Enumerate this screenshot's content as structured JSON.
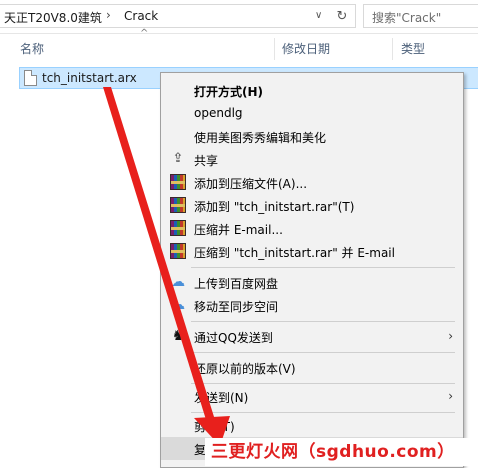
{
  "address_bar": {
    "crumbs": [
      "天正T20V8.0建筑",
      "Crack"
    ],
    "separator": "›",
    "dropdown_glyph": "∨",
    "refresh_glyph": "↻"
  },
  "search": {
    "placeholder": "搜索\"Crack\""
  },
  "columns": {
    "name": "名称",
    "modified": "修改日期",
    "type": "类型",
    "sort_glyph": "^"
  },
  "file": {
    "name": "tch_initstart.arx"
  },
  "context_menu": {
    "items": [
      {
        "label": "打开方式(H)",
        "bold": true,
        "icon": ""
      },
      {
        "label": "opendlg",
        "icon": ""
      },
      {
        "label": "使用美图秀秀编辑和美化",
        "icon": ""
      },
      {
        "label": "共享",
        "icon": "share-icon"
      },
      {
        "label": "添加到压缩文件(A)...",
        "icon": "winrar-icon"
      },
      {
        "label": "添加到 \"tch_initstart.rar\"(T)",
        "icon": "winrar-icon"
      },
      {
        "label": "压缩并 E-mail...",
        "icon": "winrar-icon"
      },
      {
        "label": "压缩到 \"tch_initstart.rar\" 并 E-mail",
        "icon": "winrar-icon"
      },
      {
        "label": "上传到百度网盘",
        "icon": "cloud-icon"
      },
      {
        "label": "移动至同步空间",
        "icon": "cloud-icon"
      },
      {
        "label": "通过QQ发送到",
        "icon": "qq-icon",
        "submenu": true
      },
      {
        "label": "还原以前的版本(V)",
        "icon": ""
      },
      {
        "label": "发送到(N)",
        "icon": "",
        "submenu": true
      },
      {
        "label": "剪切(T)",
        "icon": ""
      },
      {
        "label": "复制(C)",
        "icon": "",
        "highlighted": true
      }
    ],
    "submenu_glyph": "›"
  },
  "watermark": {
    "text": "三更灯火网（sgdhuo.com）"
  },
  "colors": {
    "selection": "#cce8ff",
    "arrow": "#e8201c",
    "watermark": "#e02020"
  }
}
